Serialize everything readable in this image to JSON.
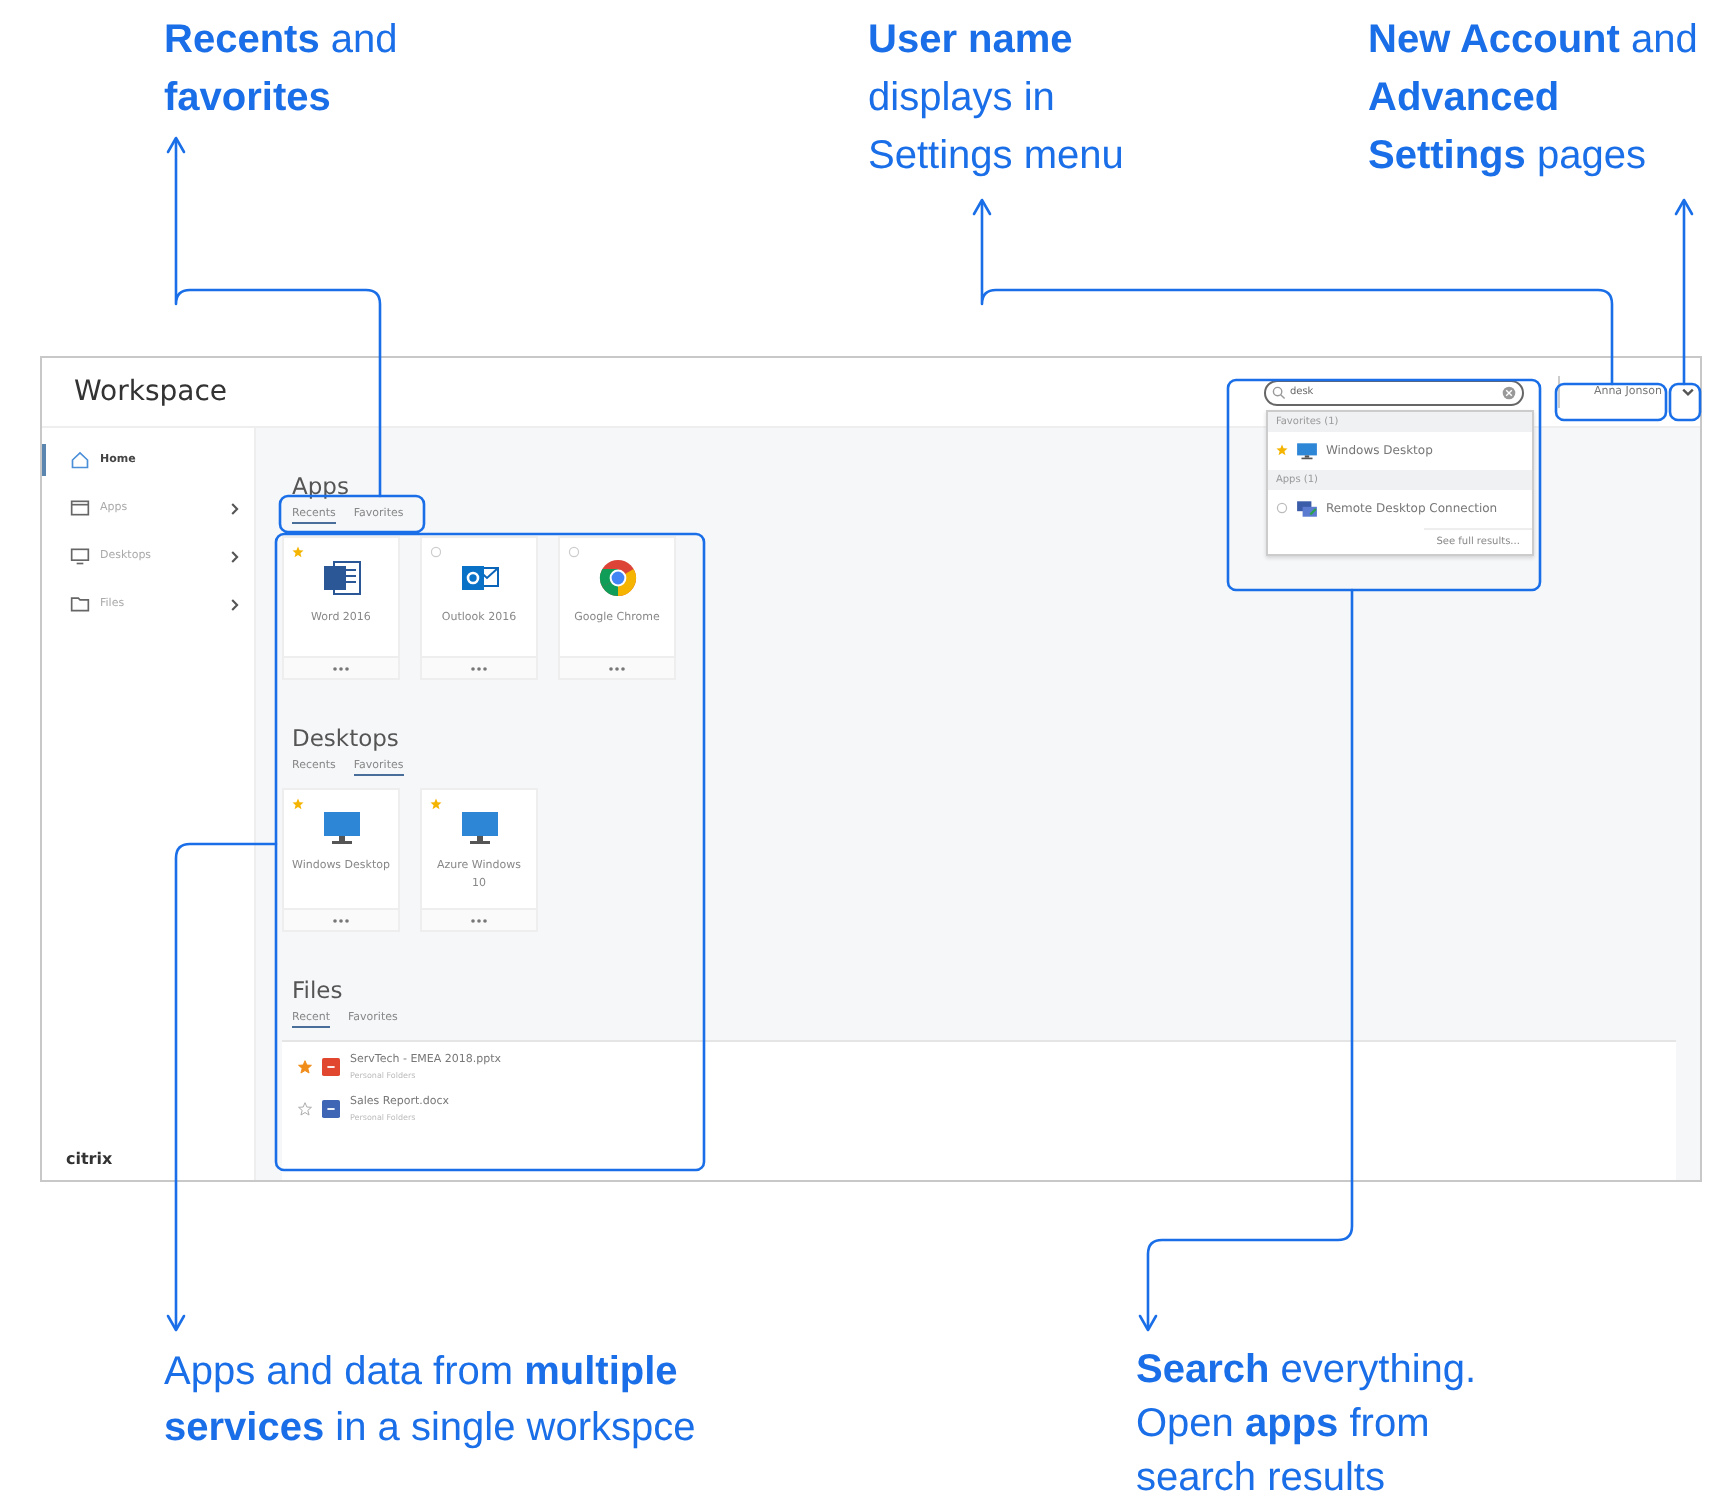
{
  "annotations": {
    "top": [
      {
        "text": "**Recents** and **favorites**"
      },
      {
        "text": "**User name** displays in Settings menu"
      },
      {
        "text": "**New Account** and **Advanced Settings** pages"
      }
    ],
    "bottom": [
      {
        "text": "Apps and data from **multiple services** in a single workspce"
      },
      {
        "text": "**Search** everything. Open **apps** from search results"
      }
    ]
  },
  "screen": {
    "title": "Workspace",
    "search": {
      "value": "desk"
    },
    "user_name": "Anna Jonson",
    "sidebar": {
      "items": [
        {
          "label": "Home",
          "selected": true,
          "kind": "home",
          "has_submenu": false
        },
        {
          "label": "Apps",
          "selected": false,
          "kind": "apps",
          "has_submenu": true
        },
        {
          "label": "Desktops",
          "selected": false,
          "kind": "desktops",
          "has_submenu": true
        },
        {
          "label": "Files",
          "selected": false,
          "kind": "files",
          "has_submenu": true
        }
      ],
      "logo": "citrix"
    },
    "search_results": {
      "groups": [
        {
          "heading": "Favorites (1)",
          "items": [
            {
              "label": "Windows Desktop",
              "favorite": true,
              "kind": "desktop"
            }
          ]
        },
        {
          "heading": "Apps (1)",
          "items": [
            {
              "label": "Remote Desktop Connection",
              "favorite": false,
              "kind": "rdc"
            }
          ]
        }
      ],
      "more_link": "See full results..."
    },
    "sections": [
      {
        "title": "Apps",
        "kind": "cards",
        "tabs": [
          {
            "label": "Recents",
            "selected": true
          },
          {
            "label": "Favorites",
            "selected": false
          }
        ],
        "cards": [
          {
            "name": "Word 2016",
            "favorite": true,
            "kind": "word"
          },
          {
            "name": "Outlook 2016",
            "favorite": false,
            "kind": "outlook"
          },
          {
            "name": "Google Chrome",
            "favorite": false,
            "kind": "chrome"
          }
        ]
      },
      {
        "title": "Desktops",
        "kind": "cards",
        "tabs": [
          {
            "label": "Recents",
            "selected": false
          },
          {
            "label": "Favorites",
            "selected": true
          }
        ],
        "cards": [
          {
            "name": "Windows Desktop",
            "favorite": true,
            "kind": "desktop"
          },
          {
            "name": "Azure Windows 10",
            "favorite": true,
            "kind": "desktop"
          }
        ]
      },
      {
        "title": "Files",
        "kind": "files",
        "tabs": [
          {
            "label": "Recent",
            "selected": true
          },
          {
            "label": "Favorites",
            "selected": false
          }
        ],
        "files": [
          {
            "name": "ServTech - EMEA 2018.pptx",
            "location": "Personal Folders",
            "favorite": true,
            "kind": "pptx"
          },
          {
            "name": "Sales Report.docx",
            "location": "Personal Folders",
            "favorite": false,
            "kind": "docx"
          }
        ]
      }
    ]
  }
}
